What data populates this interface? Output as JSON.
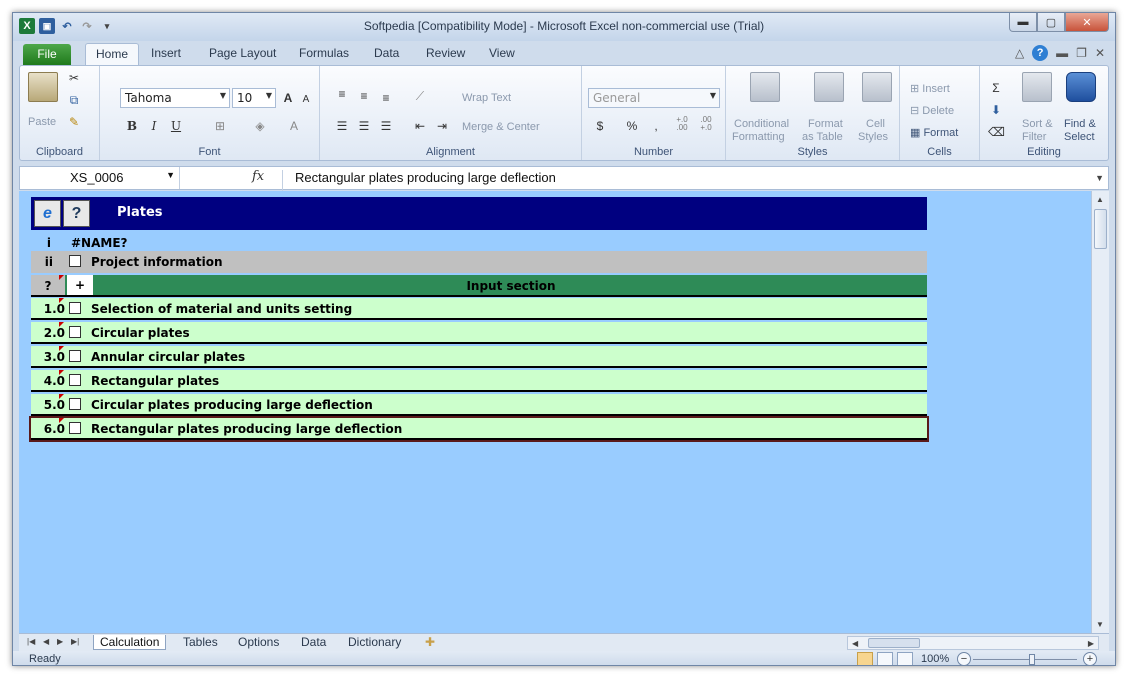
{
  "window": {
    "title": "Softpedia  [Compatibility Mode]  -  Microsoft Excel non-commercial use (Trial)"
  },
  "qat": {
    "app_icon": "excel-icon",
    "save": "save-icon",
    "undo": "undo-icon",
    "redo": "redo-icon"
  },
  "ribbon_tabs": {
    "file": "File",
    "items": [
      "Home",
      "Insert",
      "Page Layout",
      "Formulas",
      "Data",
      "Review",
      "View"
    ],
    "active": "Home"
  },
  "clipboard": {
    "label": "Clipboard",
    "paste": "Paste"
  },
  "font": {
    "label": "Font",
    "name": "Tahoma",
    "size": "10",
    "bold": "B",
    "italic": "I",
    "underline": "U",
    "grow": "A",
    "shrink": "A",
    "color_a": "A"
  },
  "alignment": {
    "label": "Alignment",
    "wrap": "Wrap Text",
    "merge": "Merge & Center"
  },
  "number": {
    "label": "Number",
    "format": "General",
    "currency": "$",
    "percent": "%",
    "comma": ",",
    "inc": "+.0\n.00",
    "dec": ".00\n+.0"
  },
  "styles": {
    "label": "Styles",
    "conditional_1": "Conditional",
    "conditional_2": "Formatting",
    "format_table_1": "Format",
    "format_table_2": "as Table",
    "cell_styles_1": "Cell",
    "cell_styles_2": "Styles"
  },
  "cells": {
    "label": "Cells",
    "insert": "Insert",
    "delete": "Delete",
    "format": "Format"
  },
  "editing": {
    "label": "Editing",
    "sort_1": "Sort &",
    "sort_2": "Filter",
    "find_1": "Find &",
    "find_2": "Select"
  },
  "formula_bar": {
    "name_box": "XS_0006",
    "fx": "fx",
    "content": "Rectangular plates producing large deflection"
  },
  "sheet": {
    "header_title": "Plates",
    "help_button": "?",
    "row_i_num": "i",
    "row_i_label": "#NAME?",
    "row_ii_num": "ii",
    "row_ii_label": "Project information",
    "input_num": "?",
    "input_plus": "+",
    "input_label": "Input section",
    "items": [
      {
        "num": "1.0",
        "label": "Selection of material and units setting"
      },
      {
        "num": "2.0",
        "label": "Circular plates"
      },
      {
        "num": "3.0",
        "label": "Annular circular plates"
      },
      {
        "num": "4.0",
        "label": "Rectangular plates"
      },
      {
        "num": "5.0",
        "label": "Circular plates producing large deflection"
      },
      {
        "num": "6.0",
        "label": "Rectangular plates producing large deflection"
      }
    ]
  },
  "sheet_tabs": [
    "Calculation",
    "Tables",
    "Options",
    "Data",
    "Dictionary"
  ],
  "status": {
    "ready": "Ready",
    "zoom": "100%"
  }
}
